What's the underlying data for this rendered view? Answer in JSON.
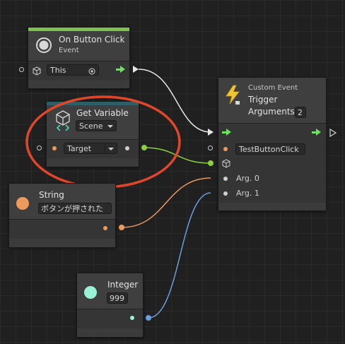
{
  "nodes": {
    "on_button_click": {
      "title": "On Button Click",
      "subtitle": "Event",
      "target_value": "This",
      "accent_color": "#7ec34d"
    },
    "get_variable": {
      "title": "Get Variable",
      "scope": "Scene",
      "variable_name": "Target",
      "accent_color": "#2f5f66"
    },
    "custom_event": {
      "title": "Custom Event",
      "subtitle": "Trigger",
      "arguments_label": "Arguments",
      "arguments_count": "2",
      "event_name": "TestButtonClick",
      "arg0_label": "Arg. 0",
      "arg1_label": "Arg. 1"
    },
    "string_literal": {
      "title": "String",
      "value": "ボタンが押された",
      "icon_color": "#ee9a5c"
    },
    "integer_literal": {
      "title": "Integer",
      "value": "999",
      "icon_color": "#9af2d6"
    }
  },
  "colors": {
    "control_flow": "#6ee15f",
    "string_port": "#ee9a5c",
    "integer_port": "#6a9edf",
    "object_port": "#8bcf3e",
    "highlight_circle": "#e0462a"
  },
  "icons": {
    "event": "radio-button-icon",
    "object": "cube-icon",
    "target_picker": "target-icon",
    "variable": "unity-variable-icon",
    "custom_event": "lightning-icon"
  }
}
